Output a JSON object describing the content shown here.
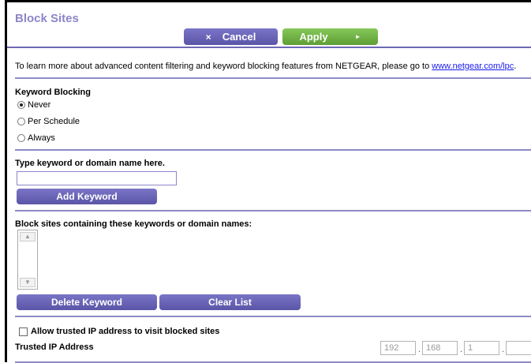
{
  "page": {
    "title": "Block Sites"
  },
  "toolbar": {
    "cancel_label": "Cancel",
    "apply_label": "Apply",
    "cancel_icon": "×",
    "apply_icon": "►"
  },
  "info": {
    "text": "To learn more about advanced content filtering and keyword blocking features from NETGEAR, please go to ",
    "link_text": "www.netgear.com/lpc",
    "suffix": "."
  },
  "keyword_blocking": {
    "label": "Keyword Blocking",
    "options": [
      {
        "label": "Never",
        "checked": true
      },
      {
        "label": "Per Schedule",
        "checked": false
      },
      {
        "label": "Always",
        "checked": false
      }
    ]
  },
  "add_keyword": {
    "label": "Type keyword or domain name here.",
    "input_value": "",
    "button_label": "Add Keyword"
  },
  "block_list": {
    "label": "Block sites containing these keywords or domain names:",
    "items": [],
    "delete_label": "Delete Keyword",
    "clear_label": "Clear List"
  },
  "trusted": {
    "checkbox_label": "Allow trusted IP address to visit blocked sites",
    "checked": false,
    "ip_label": "Trusted IP Address",
    "ip_octets": [
      "192",
      "168",
      "1",
      ""
    ]
  },
  "colors": {
    "accent": "#6e68b6",
    "apply": "#6fb242",
    "title": "#8b86c8"
  }
}
